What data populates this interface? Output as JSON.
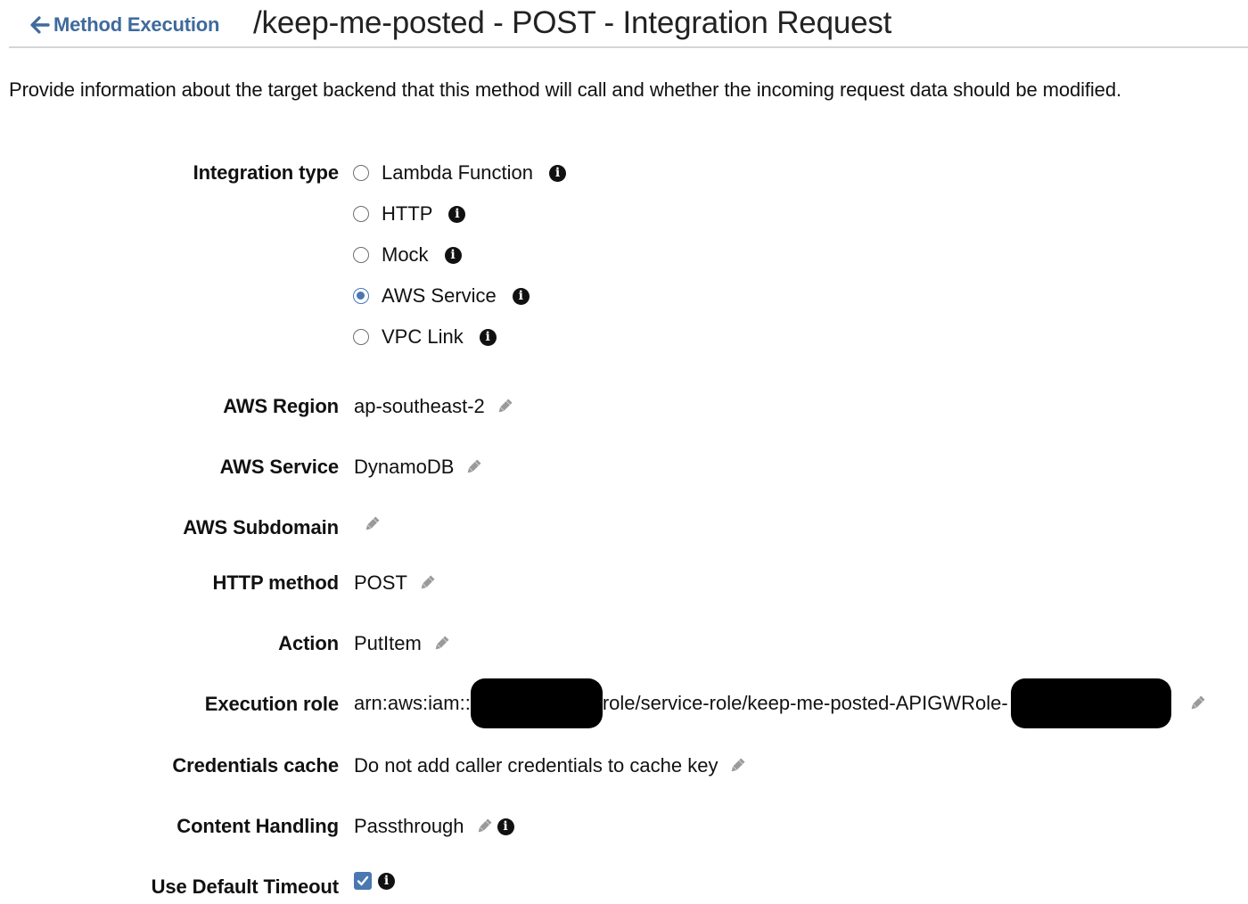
{
  "header": {
    "back_label": "Method Execution",
    "title": "/keep-me-posted - POST - Integration Request"
  },
  "description": "Provide information about the target backend that this method will call and whether the incoming request data should be modified.",
  "integration_type": {
    "label": "Integration type",
    "options": [
      {
        "label": "Lambda Function",
        "selected": false
      },
      {
        "label": "HTTP",
        "selected": false
      },
      {
        "label": "Mock",
        "selected": false
      },
      {
        "label": "AWS Service",
        "selected": true
      },
      {
        "label": "VPC Link",
        "selected": false
      }
    ]
  },
  "fields": {
    "region": {
      "label": "AWS Region",
      "value": "ap-southeast-2"
    },
    "service": {
      "label": "AWS Service",
      "value": "DynamoDB"
    },
    "subdomain": {
      "label": "AWS Subdomain",
      "value": ""
    },
    "http_method": {
      "label": "HTTP method",
      "value": "POST"
    },
    "action": {
      "label": "Action",
      "value": "PutItem"
    },
    "execution_role": {
      "label": "Execution role",
      "value_prefix": "arn:aws:iam::",
      "value_middle": "role/service-role/keep-me-posted-APIGWRole-"
    },
    "credentials_cache": {
      "label": "Credentials cache",
      "value": "Do not add caller credentials to cache key"
    },
    "content_handling": {
      "label": "Content Handling",
      "value": "Passthrough"
    },
    "default_timeout": {
      "label": "Use Default Timeout",
      "checked": true
    }
  },
  "icons": {
    "back": "arrow-left-icon",
    "info": "info-icon",
    "edit": "pencil-icon",
    "check": "checkmark-icon"
  },
  "colors": {
    "link": "#3f6a9c",
    "radio_selected": "#4a78b0",
    "checkbox": "#4a78b0",
    "redaction": "#000000"
  }
}
